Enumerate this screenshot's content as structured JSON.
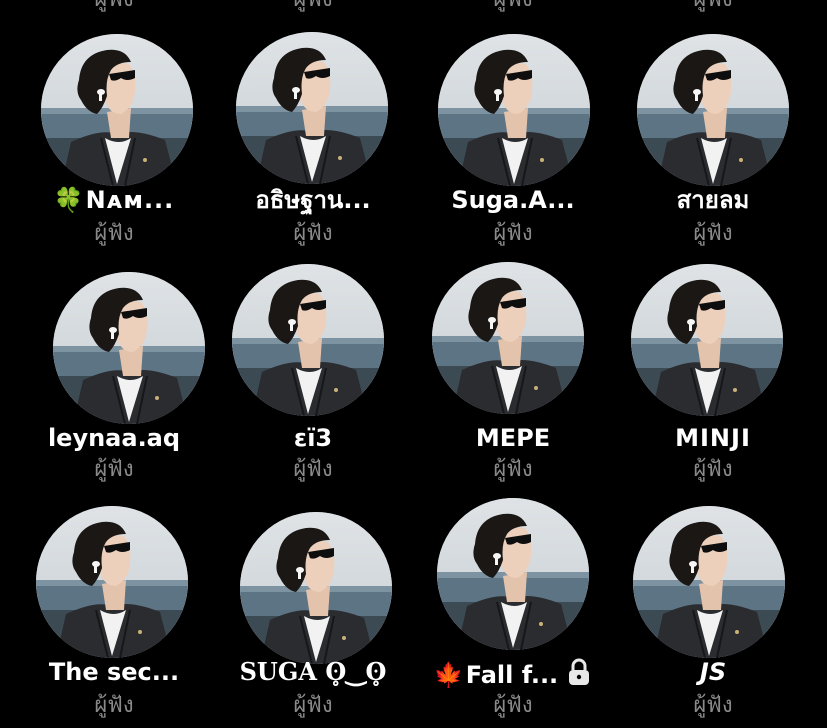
{
  "role_label": "ผู้ฟัง",
  "colors": {
    "background": "#000000",
    "name_text": "#ffffff",
    "role_text": "#8a8a8a"
  },
  "listeners": [
    {
      "name": "Nᴀᴍ...",
      "emoji": "🍀",
      "role": "ผู้ฟัง"
    },
    {
      "name": "อธิษฐาน...",
      "role": "ผู้ฟัง"
    },
    {
      "name": "Suga.A...",
      "role": "ผู้ฟัง"
    },
    {
      "name": "สายลม",
      "role": "ผู้ฟัง"
    },
    {
      "name": "leynaa.aq",
      "role": "ผู้ฟัง"
    },
    {
      "name": "εї3",
      "role": "ผู้ฟัง"
    },
    {
      "name": "MEPE",
      "role": "ผู้ฟัง"
    },
    {
      "name": "MINJI",
      "role": "ผู้ฟัง"
    },
    {
      "name": "The sec...",
      "role": "ผู้ฟัง"
    },
    {
      "name": "SUGA ʘ̥‿ʘ̥",
      "role": "ผู้ฟัง"
    },
    {
      "name": "Fall f...",
      "emoji": "🍁",
      "locked": true,
      "lock_icon": "lock-icon",
      "role": "ผู้ฟัง"
    },
    {
      "name": "JS",
      "role": "ผู้ฟัง"
    }
  ],
  "avatar_icon": "profile-photo-man-sunglasses"
}
